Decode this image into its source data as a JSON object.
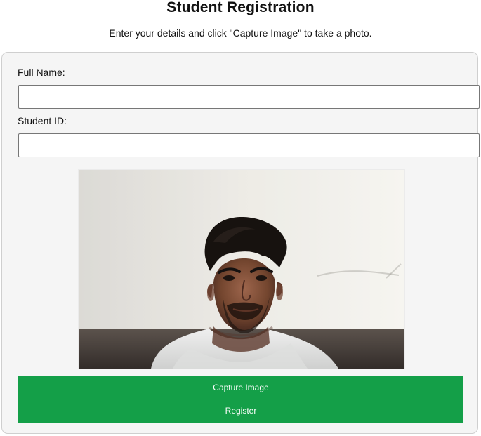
{
  "page": {
    "title": "Student Registration",
    "instructions": "Enter your details and click \"Capture Image\" to take a photo."
  },
  "form": {
    "full_name_label": "Full Name:",
    "full_name_value": "",
    "student_id_label": "Student ID:",
    "student_id_value": ""
  },
  "camera": {
    "icon": "camera-preview",
    "subject": "student-face-preview"
  },
  "actions": {
    "capture_label": "Capture Image",
    "register_label": "Register"
  },
  "colors": {
    "accent": "#149f48",
    "card_background": "#f5f5f5",
    "input_border": "#777777"
  }
}
